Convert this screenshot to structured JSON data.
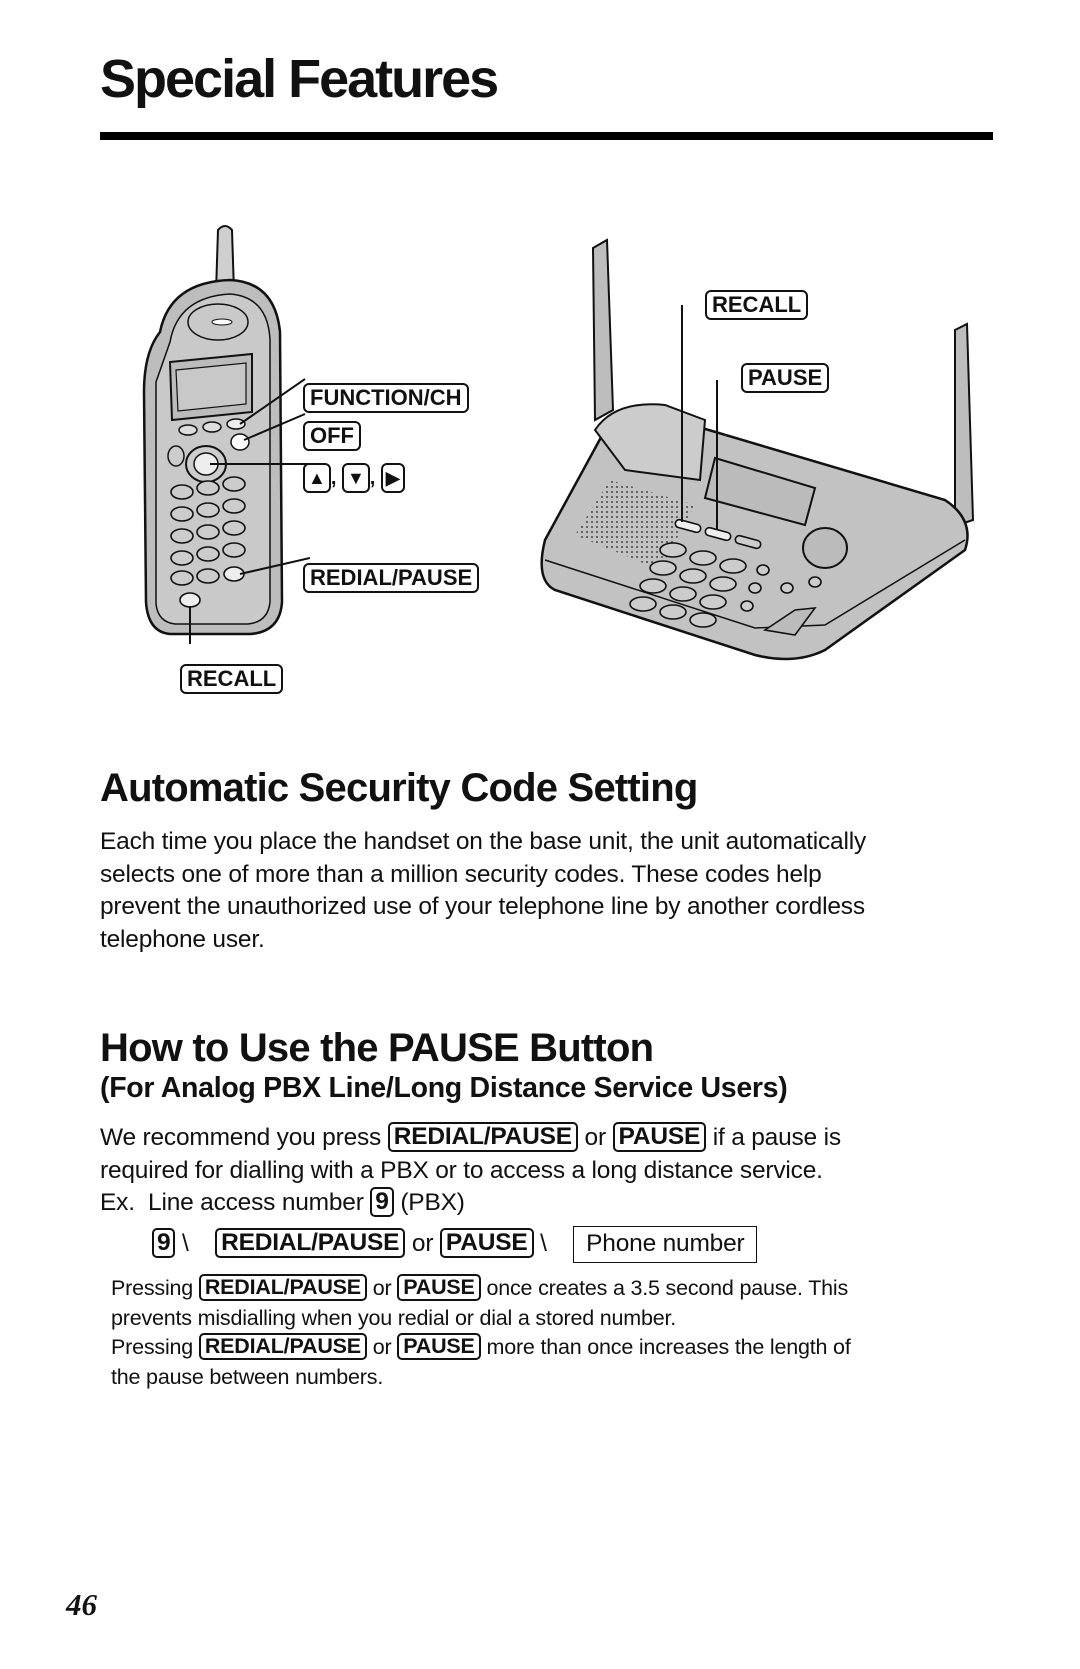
{
  "page": {
    "title": "Special Features",
    "page_number": "46"
  },
  "figure": {
    "handset_labels": {
      "function_ch": "FUNCTION/CH",
      "off": "OFF",
      "up": "▲",
      "down": "▼",
      "right": "▶",
      "separator": ",",
      "redial_pause": "REDIAL/PAUSE",
      "recall": "RECALL"
    },
    "base_labels": {
      "recall": "RECALL",
      "pause": "PAUSE"
    }
  },
  "security": {
    "heading": "Automatic Security Code Setting",
    "lines": [
      "Each time you place the handset on the base unit, the unit automatically",
      "selects one of more than a million security codes. These codes help",
      "prevent the unauthorized use of your telephone line by another cordless",
      "telephone user."
    ]
  },
  "pause_section": {
    "heading": "How to Use the PAUSE Button",
    "subheading": "(For Analog PBX Line/Long Distance Service Users)",
    "intro": {
      "line1_pre": "We recommend you press",
      "key1": "REDIAL/PAUSE",
      "or": "or",
      "key2": "PAUSE",
      "line1_post": "if a pause is",
      "line2": "required for dialling with a PBX or to access a long distance service."
    },
    "example": {
      "prefix": "Ex.",
      "text": "Line access number",
      "key": "9",
      "suffix": "(PBX)"
    },
    "flow": {
      "key_digit": "9",
      "arrow": "\\",
      "key1": "REDIAL/PAUSE",
      "or": "or",
      "key2": "PAUSE",
      "arrow2": "\\",
      "phone_number": "Phone number"
    },
    "notes": [
      {
        "pre": "Pressing",
        "key1": "REDIAL/PAUSE",
        "or": "or",
        "key2": "PAUSE",
        "post": "once creates a 3.5 second pause. This",
        "line2": "prevents misdialling when you redial or dial a stored number."
      },
      {
        "pre": "Pressing",
        "key1": "REDIAL/PAUSE",
        "or": "or",
        "key2": "PAUSE",
        "post": "more than once increases the length of",
        "line2": "the pause between numbers."
      }
    ]
  }
}
